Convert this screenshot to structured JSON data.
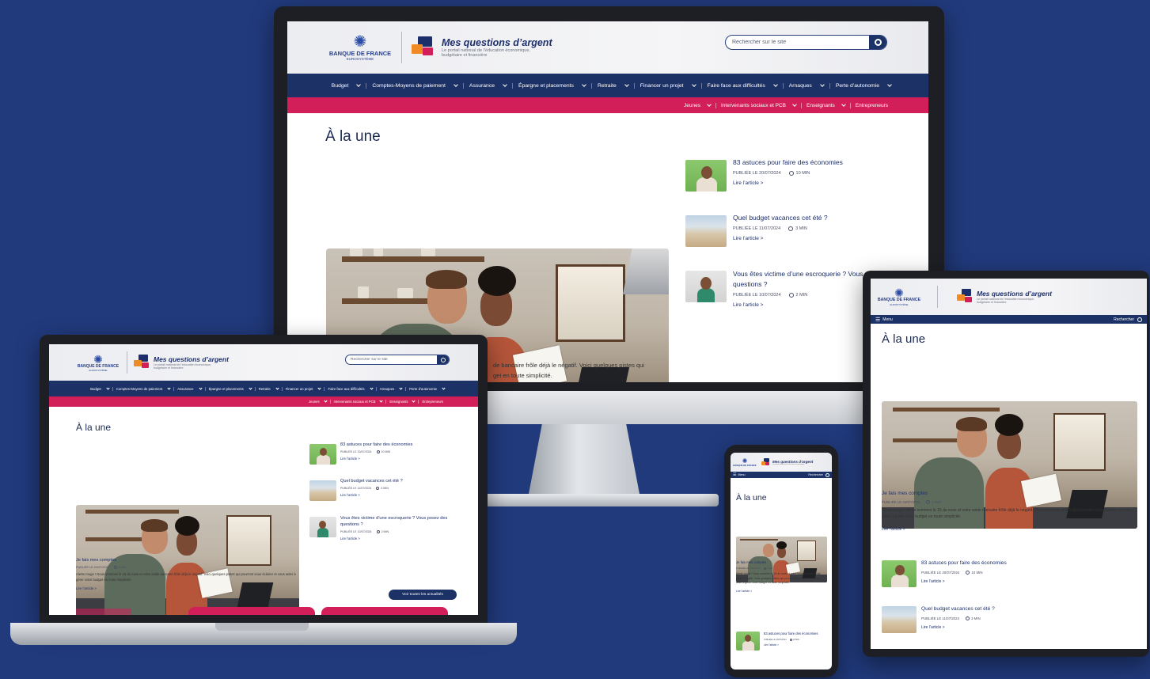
{
  "site": {
    "bdf_logo": "BANQUE DE FRANCE",
    "bdf_sub": "EUROSYSTÈME",
    "brand_title": "Mes questions d’argent",
    "brand_tagline_1": "Le portail national de l’éducation économique,",
    "brand_tagline_2": "budgétaire et financière",
    "search_placeholder": "Rechercher sur le site",
    "nav": [
      "Budget",
      "Comptes-Moyens de paiement",
      "Assurance",
      "Épargne et placements",
      "Retraite",
      "Financer un projet",
      "Faire face aux difficultés",
      "Arnaques",
      "Perte d’autonomie"
    ],
    "subnav": [
      "Jeunes",
      "Intervenants sociaux et PCB",
      "Enseignants",
      "Entrepreneurs"
    ],
    "section_title": "À la une",
    "menu_label": "Menu",
    "mobile_search_label": "Rechercher"
  },
  "main_article": {
    "title": "Je fais mes comptes",
    "meta": "PUBLIÉE LE 24/07/2024",
    "read_time": "5 MIN",
    "excerpt": "Alerte rouge ! Nous sommes le 15 du mois et votre solde bancaire frôle déjà le négatif. Voici quelques pistes qui pourront vous éclairer et vous aider à gérer votre budget en toute simplicité.",
    "excerpt_tail_1": "de bancaire frôle déjà le négatif. Voici quelques pistes qui",
    "excerpt_tail_2": "get en toute simplicité.",
    "link": "Lire l’article >"
  },
  "articles": [
    {
      "title": "83 astuces pour faire des économies",
      "meta": "PUBLIÉE LE 20/07/2024",
      "read_time": "10 MIN",
      "link": "Lire l’article >"
    },
    {
      "title": "Quel budget vacances cet été ?",
      "meta": "PUBLIÉE LE 11/07/2024",
      "read_time": "3 MIN",
      "link": "Lire l’article >"
    },
    {
      "title": "Vous êtes victime d’une escroquerie ? Vous posez des questions ?",
      "meta": "PUBLIÉE LE 10/07/2024",
      "read_time": "2 MIN",
      "link": "Lire l’article >"
    }
  ],
  "buttons": {
    "all_news": "Voir toutes les actualités"
  },
  "colors": {
    "background": "#213a7c",
    "nav": "#1c3166",
    "accent_pink": "#d21e59"
  }
}
